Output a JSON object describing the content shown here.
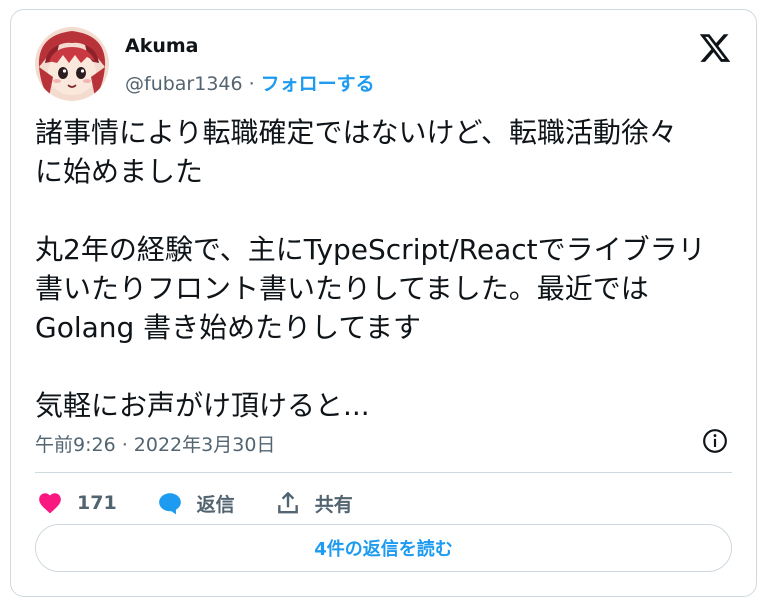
{
  "author": {
    "name": "Akuma",
    "handle": "@fubar1346",
    "separator": "·",
    "follow_label": "フォローする"
  },
  "tweet": {
    "lines": [
      "諸事情により転職確定ではないけど、転職活動徐々",
      "に始めました",
      "",
      "丸2年の経験で、主にTypeScript/Reactでライブラリ",
      "書いたりフロント書いたりしてました。最近では",
      "Golang 書き始めたりしてます",
      "",
      "気軽にお声がけ頂けると..."
    ],
    "timestamp": "午前9:26 · 2022年3月30日"
  },
  "actions": {
    "like_count": "171",
    "reply_label": "返信",
    "share_label": "共有"
  },
  "read_replies_label": "4件の返信を読む",
  "colors": {
    "accent": "#1d9bf0",
    "like": "#f91880",
    "text": "#0f1419",
    "muted": "#536471",
    "border": "#cfd9de"
  },
  "icons": [
    "avatar-illustration",
    "x-logo-icon",
    "info-icon",
    "heart-icon",
    "reply-bubble-icon",
    "share-icon"
  ]
}
